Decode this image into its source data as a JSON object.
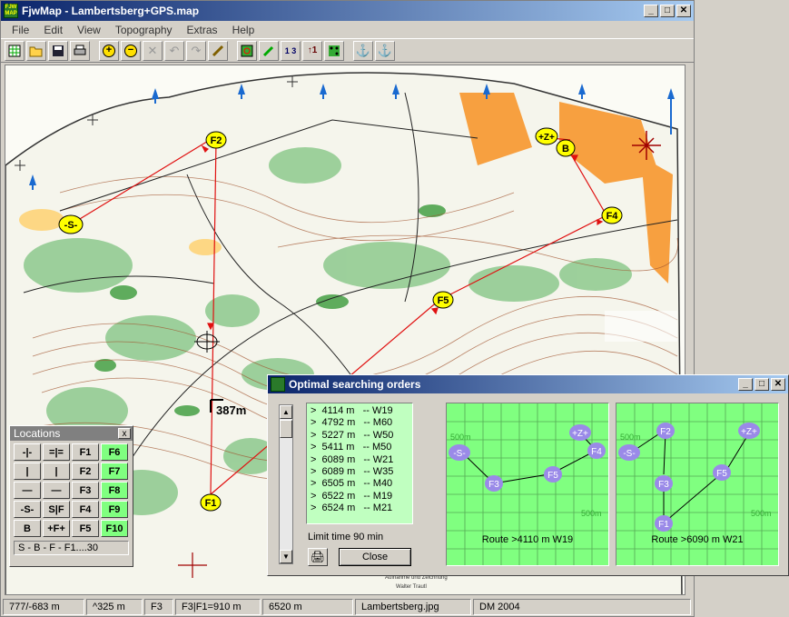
{
  "window": {
    "title": "FjwMap - Lambertsberg+GPS.map",
    "minimize": "_",
    "maximize": "□",
    "close": "✕"
  },
  "menu": [
    "File",
    "Edit",
    "View",
    "Topography",
    "Extras",
    "Help"
  ],
  "map": {
    "controls": {
      "start": "-S-",
      "f1": "F1",
      "f2": "F2",
      "f3": "F3",
      "f4": "F4",
      "f5": "F5",
      "b": "B",
      "z": "+Z+"
    },
    "distance_label": "387m",
    "credits": "Aufnahme und Zeichnung",
    "credits_name": "Walter Trautl"
  },
  "locations": {
    "title": "Locations",
    "close": "x",
    "buttons": [
      "-|-",
      "=|=",
      "F1",
      "F6",
      "|",
      "|",
      "F2",
      "F7",
      "—",
      "—",
      "F3",
      "F8",
      "-S-",
      "S|F",
      "F4",
      "F9",
      "B",
      "+F+",
      "F5",
      "F10"
    ],
    "footer": "S - B - F - F1....30"
  },
  "dialog": {
    "title": "Optimal searching orders",
    "list": [
      ">  4114 m   -- W19",
      ">  4792 m   -- M60",
      ">  5227 m   -- W50",
      ">  5411 m   -- M50",
      ">  6089 m   -- W21",
      ">  6089 m   -- W35",
      ">  6505 m   -- M40",
      ">  6522 m   -- M19",
      ">  6524 m   -- M21"
    ],
    "limit": "Limit time 90 min",
    "close_label": "Close",
    "route1": {
      "label": "Route >4110 m  W19",
      "grid_label_top": "500m",
      "grid_label_bottom": "500m",
      "nodes": {
        "s": "-S-",
        "f3": "F3",
        "f5": "F5",
        "f4": "F4",
        "z": "+Z+"
      }
    },
    "route2": {
      "label": "Route >6090 m  W21",
      "grid_label_top": "500m",
      "grid_label_bottom": "500m",
      "nodes": {
        "s": "-S-",
        "f2": "F2",
        "f3": "F3",
        "f1": "F1",
        "f5": "F5",
        "z": "+Z+"
      }
    }
  },
  "status": [
    "777/-683 m",
    "^325 m",
    "F3",
    "F3|F1=910 m",
    "6520 m",
    "Lambertsberg.jpg",
    "DM 2004"
  ]
}
